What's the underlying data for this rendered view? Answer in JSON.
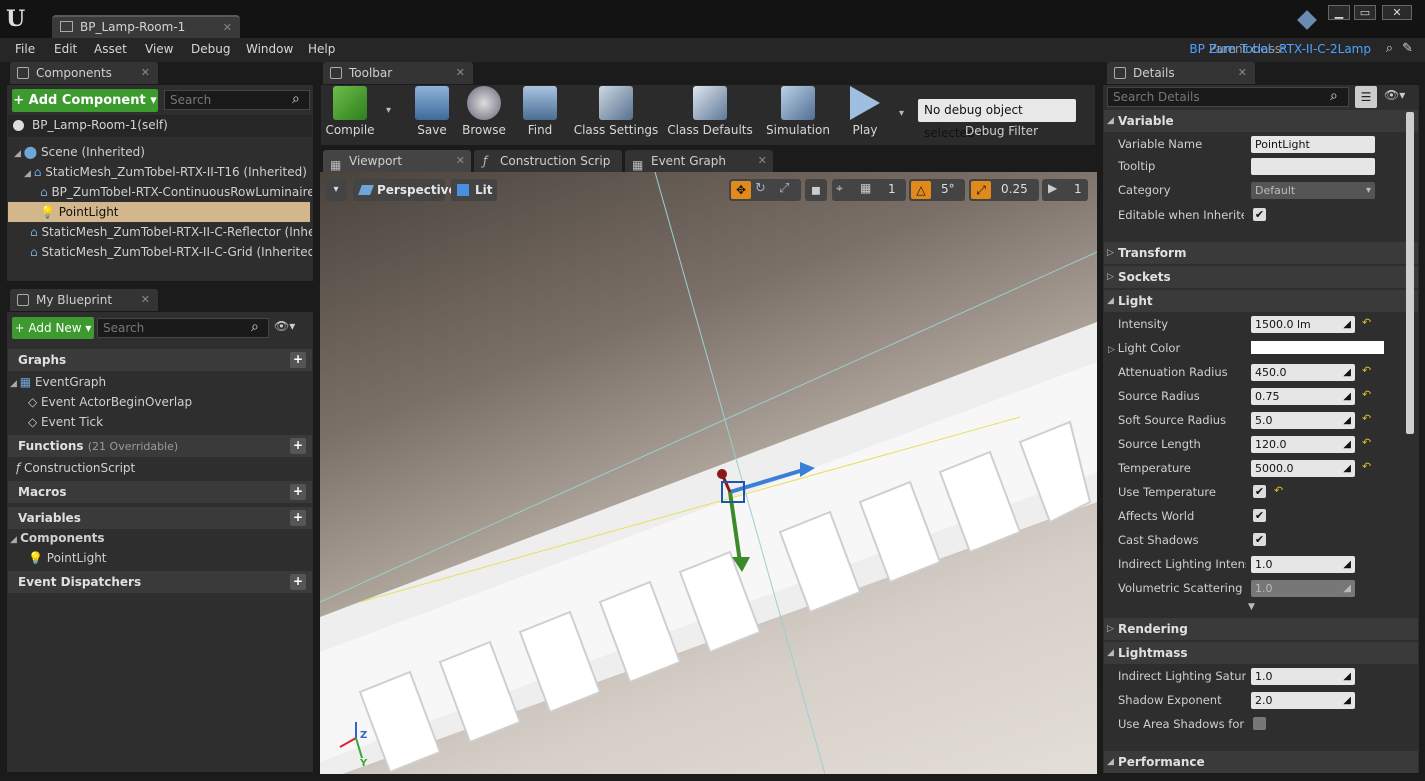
{
  "window": {
    "tab_title": "BP_Lamp-Room-1",
    "minimize": "▁",
    "maximize": "▭",
    "close": "✕"
  },
  "menu": [
    "File",
    "Edit",
    "Asset",
    "View",
    "Debug",
    "Window",
    "Help"
  ],
  "parent_class": {
    "label": "Parent class:",
    "value": "BP Zum Tobel- RTX-II-C-2Lamp"
  },
  "components": {
    "tab": "Components",
    "add_button": "+ Add Component ▾",
    "search_placeholder": "Search",
    "self": "BP_Lamp-Room-1(self)",
    "tree": [
      "Scene (Inherited)",
      "StaticMesh_ZumTobel-RTX-II-T16 (Inherited)",
      "BP_ZumTobel-RTX-ContinuousRowLuminaire-",
      "PointLight",
      "StaticMesh_ZumTobel-RTX-II-C-Reflector (Inherit",
      "StaticMesh_ZumTobel-RTX-II-C-Grid (Inherited)"
    ]
  },
  "my_blueprint": {
    "tab": "My Blueprint",
    "add_new": "+ Add New ▾",
    "search_placeholder": "Search",
    "graphs": "Graphs",
    "event_graph": "EventGraph",
    "events": [
      "Event ActorBeginOverlap",
      "Event Tick"
    ],
    "functions": "Functions",
    "functions_note": "(21 Overridable)",
    "construction_script": "ConstructionScript",
    "macros": "Macros",
    "variables": "Variables",
    "components_cat": "Components",
    "point_light": "PointLight",
    "event_dispatchers": "Event Dispatchers"
  },
  "toolbar": {
    "tab": "Toolbar",
    "buttons": [
      "Compile",
      "Save",
      "Browse",
      "Find",
      "Class Settings",
      "Class Defaults",
      "Simulation",
      "Play"
    ],
    "debug_select": "No debug object selected ▾",
    "debug_filter": "Debug Filter"
  },
  "editor_tabs": [
    "Viewport",
    "Construction Scrip",
    "Event Graph"
  ],
  "viewport": {
    "perspective": "Perspective",
    "lit": "Lit",
    "snap_rot": "5°",
    "snap_scale": "0.25",
    "grid_num": "1",
    "cam_speed": "1",
    "axis_z": "Z",
    "axis_y": "Y"
  },
  "details": {
    "tab": "Details",
    "search_placeholder": "Search Details",
    "variable_section": "Variable",
    "variable_rows": [
      {
        "name": "Variable Name",
        "value": "PointLight"
      },
      {
        "name": "Tooltip",
        "value": ""
      },
      {
        "name": "Category",
        "value": "Default"
      },
      {
        "name": "Editable when Inherited",
        "value": "✔"
      }
    ],
    "transform": "Transform",
    "sockets": "Sockets",
    "light_section": "Light",
    "light_rows": [
      {
        "name": "Intensity",
        "value": "1500.0 lm"
      },
      {
        "name": "Light Color",
        "value": ""
      },
      {
        "name": "Attenuation Radius",
        "value": "450.0"
      },
      {
        "name": "Source Radius",
        "value": "0.75"
      },
      {
        "name": "Soft Source Radius",
        "value": "5.0"
      },
      {
        "name": "Source Length",
        "value": "120.0"
      },
      {
        "name": "Temperature",
        "value": "5000.0"
      },
      {
        "name": "Use Temperature",
        "value": "✔"
      },
      {
        "name": "Affects World",
        "value": "✔"
      },
      {
        "name": "Cast Shadows",
        "value": "✔"
      },
      {
        "name": "Indirect Lighting Intensity",
        "value": "1.0"
      },
      {
        "name": "Volumetric Scattering Int",
        "value": "1.0"
      }
    ],
    "rendering": "Rendering",
    "lightmass": "Lightmass",
    "lightmass_rows": [
      {
        "name": "Indirect Lighting Saturatio",
        "value": "1.0"
      },
      {
        "name": "Shadow Exponent",
        "value": "2.0"
      },
      {
        "name": "Use Area Shadows for Sta",
        "value": ""
      }
    ],
    "performance": "Performance"
  },
  "colors": {
    "accent_green": "#3c9a2e",
    "selection": "#d3b68c",
    "link_blue": "#4ea3ff",
    "reset_yellow": "#e2c02a"
  }
}
